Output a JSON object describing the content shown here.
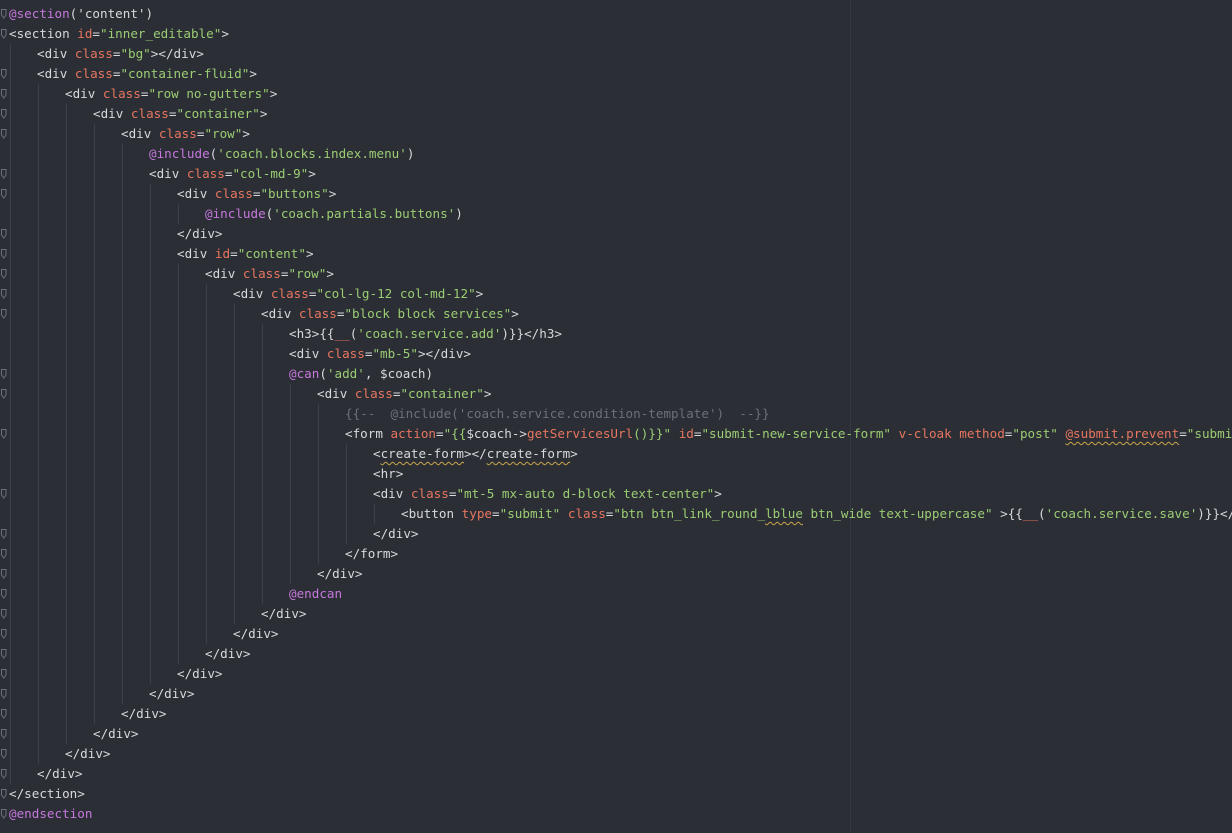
{
  "editor": {
    "colors": {
      "background": "#2b2e35",
      "directive": "#c678dd",
      "attribute": "#e8765f",
      "string": "#9bcd73",
      "text": "#d7d9dd",
      "comment": "#6b7079"
    },
    "lines": [
      {
        "indent": 0,
        "fold": true,
        "tokens": [
          {
            "t": "@section",
            "k": "directive"
          },
          {
            "t": "('content')",
            "k": "text"
          }
        ]
      },
      {
        "indent": 0,
        "fold": true,
        "tokens": [
          {
            "t": "<section ",
            "k": "tag"
          },
          {
            "t": "id",
            "k": "attr"
          },
          {
            "t": "=",
            "k": "punct"
          },
          {
            "t": "\"inner_editable\"",
            "k": "string"
          },
          {
            "t": ">",
            "k": "tag"
          }
        ]
      },
      {
        "indent": 1,
        "fold": false,
        "tokens": [
          {
            "t": "<div ",
            "k": "tag"
          },
          {
            "t": "class",
            "k": "attr"
          },
          {
            "t": "=",
            "k": "punct"
          },
          {
            "t": "\"bg\"",
            "k": "string"
          },
          {
            "t": "></div>",
            "k": "tag"
          }
        ]
      },
      {
        "indent": 1,
        "fold": true,
        "tokens": [
          {
            "t": "<div ",
            "k": "tag"
          },
          {
            "t": "class",
            "k": "attr"
          },
          {
            "t": "=",
            "k": "punct"
          },
          {
            "t": "\"container-fluid\"",
            "k": "string"
          },
          {
            "t": ">",
            "k": "tag"
          }
        ]
      },
      {
        "indent": 2,
        "fold": true,
        "tokens": [
          {
            "t": "<div ",
            "k": "tag"
          },
          {
            "t": "class",
            "k": "attr"
          },
          {
            "t": "=",
            "k": "punct"
          },
          {
            "t": "\"row no-gutters\"",
            "k": "string"
          },
          {
            "t": ">",
            "k": "tag"
          }
        ]
      },
      {
        "indent": 3,
        "fold": true,
        "tokens": [
          {
            "t": "<div ",
            "k": "tag"
          },
          {
            "t": "class",
            "k": "attr"
          },
          {
            "t": "=",
            "k": "punct"
          },
          {
            "t": "\"container\"",
            "k": "string"
          },
          {
            "t": ">",
            "k": "tag"
          }
        ]
      },
      {
        "indent": 4,
        "fold": true,
        "tokens": [
          {
            "t": "<div ",
            "k": "tag"
          },
          {
            "t": "class",
            "k": "attr"
          },
          {
            "t": "=",
            "k": "punct"
          },
          {
            "t": "\"row\"",
            "k": "string"
          },
          {
            "t": ">",
            "k": "tag"
          }
        ]
      },
      {
        "indent": 5,
        "fold": false,
        "tokens": [
          {
            "t": "@include",
            "k": "directive"
          },
          {
            "t": "(",
            "k": "text"
          },
          {
            "t": "'coach.blocks.index.menu'",
            "k": "string"
          },
          {
            "t": ")",
            "k": "text"
          }
        ]
      },
      {
        "indent": 5,
        "fold": true,
        "tokens": [
          {
            "t": "<div ",
            "k": "tag"
          },
          {
            "t": "class",
            "k": "attr"
          },
          {
            "t": "=",
            "k": "punct"
          },
          {
            "t": "\"col-md-9\"",
            "k": "string"
          },
          {
            "t": ">",
            "k": "tag"
          }
        ]
      },
      {
        "indent": 6,
        "fold": true,
        "tokens": [
          {
            "t": "<div ",
            "k": "tag"
          },
          {
            "t": "class",
            "k": "attr"
          },
          {
            "t": "=",
            "k": "punct"
          },
          {
            "t": "\"buttons\"",
            "k": "string"
          },
          {
            "t": ">",
            "k": "tag"
          }
        ]
      },
      {
        "indent": 7,
        "fold": false,
        "tokens": [
          {
            "t": "@include",
            "k": "directive"
          },
          {
            "t": "(",
            "k": "text"
          },
          {
            "t": "'coach.partials.buttons'",
            "k": "string"
          },
          {
            "t": ")",
            "k": "text"
          }
        ]
      },
      {
        "indent": 6,
        "fold": true,
        "tokens": [
          {
            "t": "</div>",
            "k": "tag"
          }
        ]
      },
      {
        "indent": 6,
        "fold": true,
        "tokens": [
          {
            "t": "<div ",
            "k": "tag"
          },
          {
            "t": "id",
            "k": "attr"
          },
          {
            "t": "=",
            "k": "punct"
          },
          {
            "t": "\"content\"",
            "k": "string"
          },
          {
            "t": ">",
            "k": "tag"
          }
        ]
      },
      {
        "indent": 7,
        "fold": true,
        "tokens": [
          {
            "t": "<div ",
            "k": "tag"
          },
          {
            "t": "class",
            "k": "attr"
          },
          {
            "t": "=",
            "k": "punct"
          },
          {
            "t": "\"row\"",
            "k": "string"
          },
          {
            "t": ">",
            "k": "tag"
          }
        ]
      },
      {
        "indent": 8,
        "fold": true,
        "tokens": [
          {
            "t": "<div ",
            "k": "tag"
          },
          {
            "t": "class",
            "k": "attr"
          },
          {
            "t": "=",
            "k": "punct"
          },
          {
            "t": "\"col-lg-12 col-md-12\"",
            "k": "string"
          },
          {
            "t": ">",
            "k": "tag"
          }
        ]
      },
      {
        "indent": 9,
        "fold": true,
        "tokens": [
          {
            "t": "<div ",
            "k": "tag"
          },
          {
            "t": "class",
            "k": "attr"
          },
          {
            "t": "=",
            "k": "punct"
          },
          {
            "t": "\"block block services\"",
            "k": "string"
          },
          {
            "t": ">",
            "k": "tag"
          }
        ]
      },
      {
        "indent": 10,
        "fold": false,
        "tokens": [
          {
            "t": "<h3>",
            "k": "tag"
          },
          {
            "t": "{{",
            "k": "text"
          },
          {
            "t": "__",
            "k": "func"
          },
          {
            "t": "(",
            "k": "text"
          },
          {
            "t": "'coach.service.add'",
            "k": "string"
          },
          {
            "t": ")}}",
            "k": "text"
          },
          {
            "t": "</h3>",
            "k": "tag"
          }
        ]
      },
      {
        "indent": 10,
        "fold": false,
        "tokens": [
          {
            "t": "<div ",
            "k": "tag"
          },
          {
            "t": "class",
            "k": "attr"
          },
          {
            "t": "=",
            "k": "punct"
          },
          {
            "t": "\"mb-5\"",
            "k": "string"
          },
          {
            "t": "></div>",
            "k": "tag"
          }
        ]
      },
      {
        "indent": 10,
        "fold": true,
        "tokens": [
          {
            "t": "@can",
            "k": "directive"
          },
          {
            "t": "(",
            "k": "text"
          },
          {
            "t": "'add'",
            "k": "string"
          },
          {
            "t": ", $coach)",
            "k": "text"
          }
        ]
      },
      {
        "indent": 11,
        "fold": true,
        "tokens": [
          {
            "t": "<div ",
            "k": "tag"
          },
          {
            "t": "class",
            "k": "attr"
          },
          {
            "t": "=",
            "k": "punct"
          },
          {
            "t": "\"container\"",
            "k": "string"
          },
          {
            "t": ">",
            "k": "tag"
          }
        ]
      },
      {
        "indent": 12,
        "fold": false,
        "tokens": [
          {
            "t": "{{--  @include('coach.service.condition-template')  --}}",
            "k": "comment"
          }
        ]
      },
      {
        "indent": 12,
        "fold": true,
        "tokens": [
          {
            "t": "<form ",
            "k": "tag"
          },
          {
            "t": "action",
            "k": "attr"
          },
          {
            "t": "=",
            "k": "punct"
          },
          {
            "t": "\"{{",
            "k": "string"
          },
          {
            "t": "$coach->",
            "k": "var"
          },
          {
            "t": "getServicesUrl",
            "k": "func"
          },
          {
            "t": "()}}\"",
            "k": "string"
          },
          {
            "t": " ",
            "k": "text"
          },
          {
            "t": "id",
            "k": "attr"
          },
          {
            "t": "=",
            "k": "punct"
          },
          {
            "t": "\"submit-new-service-form\"",
            "k": "string"
          },
          {
            "t": " ",
            "k": "text"
          },
          {
            "t": "v-cloak",
            "k": "attr"
          },
          {
            "t": " ",
            "k": "text"
          },
          {
            "t": "method",
            "k": "attr"
          },
          {
            "t": "=",
            "k": "punct"
          },
          {
            "t": "\"post\"",
            "k": "string"
          },
          {
            "t": " ",
            "k": "text"
          },
          {
            "t": "@submit.prevent",
            "k": "attr",
            "squiggle": true
          },
          {
            "t": "=",
            "k": "punct"
          },
          {
            "t": "\"submit\"",
            "k": "string"
          },
          {
            "t": ">",
            "k": "tag"
          }
        ]
      },
      {
        "indent": 13,
        "fold": false,
        "tokens": [
          {
            "t": "<",
            "k": "tag"
          },
          {
            "t": "create-form",
            "k": "tag",
            "squiggle": true
          },
          {
            "t": "></",
            "k": "tag"
          },
          {
            "t": "create-form",
            "k": "tag",
            "squiggle": true
          },
          {
            "t": ">",
            "k": "tag"
          }
        ]
      },
      {
        "indent": 13,
        "fold": false,
        "tokens": [
          {
            "t": "<hr>",
            "k": "tag"
          }
        ]
      },
      {
        "indent": 13,
        "fold": true,
        "tokens": [
          {
            "t": "<div ",
            "k": "tag"
          },
          {
            "t": "class",
            "k": "attr"
          },
          {
            "t": "=",
            "k": "punct"
          },
          {
            "t": "\"mt-5 mx-auto d-block text-center\"",
            "k": "string"
          },
          {
            "t": ">",
            "k": "tag"
          }
        ]
      },
      {
        "indent": 14,
        "fold": false,
        "tokens": [
          {
            "t": "<button ",
            "k": "tag"
          },
          {
            "t": "type",
            "k": "attr"
          },
          {
            "t": "=",
            "k": "punct"
          },
          {
            "t": "\"submit\"",
            "k": "string"
          },
          {
            "t": " ",
            "k": "text"
          },
          {
            "t": "class",
            "k": "attr"
          },
          {
            "t": "=",
            "k": "punct"
          },
          {
            "t": "\"btn btn_link_round_",
            "k": "string"
          },
          {
            "t": "lblue",
            "k": "string",
            "squiggle": true
          },
          {
            "t": " btn_wide text-uppercase\"",
            "k": "string"
          },
          {
            "t": " >",
            "k": "tag"
          },
          {
            "t": "{{",
            "k": "text"
          },
          {
            "t": "__",
            "k": "func"
          },
          {
            "t": "(",
            "k": "text"
          },
          {
            "t": "'coach.service.save'",
            "k": "string"
          },
          {
            "t": ")}}",
            "k": "text"
          },
          {
            "t": "</button>",
            "k": "tag"
          }
        ]
      },
      {
        "indent": 13,
        "fold": true,
        "tokens": [
          {
            "t": "</div>",
            "k": "tag"
          }
        ]
      },
      {
        "indent": 12,
        "fold": true,
        "tokens": [
          {
            "t": "</form>",
            "k": "tag"
          }
        ]
      },
      {
        "indent": 11,
        "fold": true,
        "tokens": [
          {
            "t": "</div>",
            "k": "tag"
          }
        ]
      },
      {
        "indent": 10,
        "fold": true,
        "tokens": [
          {
            "t": "@endcan",
            "k": "directive"
          }
        ]
      },
      {
        "indent": 9,
        "fold": true,
        "tokens": [
          {
            "t": "</div>",
            "k": "tag"
          }
        ]
      },
      {
        "indent": 8,
        "fold": true,
        "tokens": [
          {
            "t": "</div>",
            "k": "tag"
          }
        ]
      },
      {
        "indent": 7,
        "fold": true,
        "tokens": [
          {
            "t": "</div>",
            "k": "tag"
          }
        ]
      },
      {
        "indent": 6,
        "fold": true,
        "tokens": [
          {
            "t": "</div>",
            "k": "tag"
          }
        ]
      },
      {
        "indent": 5,
        "fold": true,
        "tokens": [
          {
            "t": "</div>",
            "k": "tag"
          }
        ]
      },
      {
        "indent": 4,
        "fold": true,
        "tokens": [
          {
            "t": "</div>",
            "k": "tag"
          }
        ]
      },
      {
        "indent": 3,
        "fold": true,
        "tokens": [
          {
            "t": "</div>",
            "k": "tag"
          }
        ]
      },
      {
        "indent": 2,
        "fold": true,
        "tokens": [
          {
            "t": "</div>",
            "k": "tag"
          }
        ]
      },
      {
        "indent": 1,
        "fold": true,
        "tokens": [
          {
            "t": "</div>",
            "k": "tag"
          }
        ]
      },
      {
        "indent": 0,
        "fold": true,
        "tokens": [
          {
            "t": "</section>",
            "k": "tag"
          }
        ]
      },
      {
        "indent": 0,
        "fold": true,
        "tokens": [
          {
            "t": "@endsection",
            "k": "directive"
          }
        ]
      }
    ]
  }
}
